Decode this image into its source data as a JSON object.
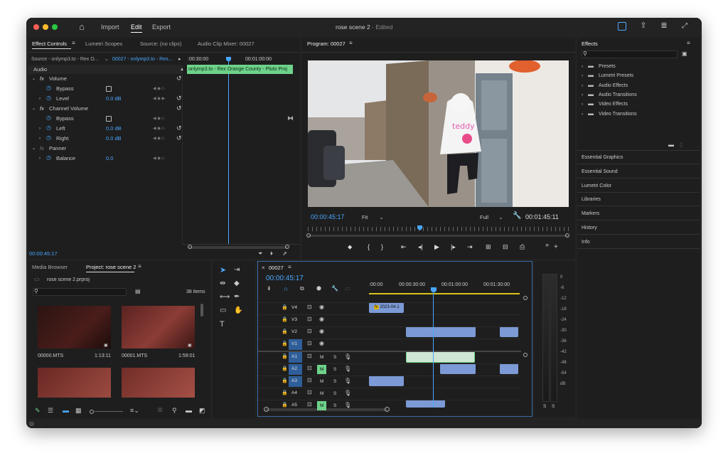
{
  "title_bar": {
    "home": "⌂",
    "import": "Import",
    "edit": "Edit",
    "export": "Export",
    "title": "rose scene 2",
    "edited": " - Edited"
  },
  "effect_controls": {
    "tab_effect": "Effect Controls",
    "tab_lumetri": "Lumetri Scopes",
    "tab_source": "Source: (no clips)",
    "tab_mixer": "Audio Clip Mixer: 00027",
    "source_label": "Source - onlymp3.to - Rex O...",
    "seq_label": "00027 - onlymp3.to - Rex...",
    "ruler_start": ":00:30:00",
    "ruler_end": "00:01:00:00",
    "clip": "onlymp3.to - Rex Orange County - Pluto Proj",
    "section": "Audio",
    "rows": [
      {
        "name": "Volume",
        "fx": "fx",
        "kind": "group"
      },
      {
        "name": "Bypass",
        "kind": "check"
      },
      {
        "name": "Level",
        "value": "0.0 dB",
        "kind": "param"
      },
      {
        "name": "Channel Volume",
        "fx": "fx",
        "kind": "group"
      },
      {
        "name": "Bypass",
        "kind": "check"
      },
      {
        "name": "Left",
        "value": "0.0 dB",
        "kind": "param"
      },
      {
        "name": "Right",
        "value": "0.0 dB",
        "kind": "param"
      },
      {
        "name": "Panner",
        "fx": "fx",
        "kind": "group"
      },
      {
        "name": "Balance",
        "value": "0.0",
        "kind": "param"
      }
    ],
    "timecode": "00:00:45:17"
  },
  "program": {
    "tab": "Program: 00027",
    "timecode": "00:00:45:17",
    "fit": "Fit",
    "full": "Full",
    "duration": "00:01:45:11"
  },
  "effects": {
    "title": "Effects",
    "folders": [
      "Presets",
      "Lumetri Presets",
      "Audio Effects",
      "Audio Transitions",
      "Video Effects",
      "Video Transitions"
    ],
    "panels": [
      "Essential Graphics",
      "Essential Sound",
      "Lumetri Color",
      "Libraries",
      "Markers",
      "History",
      "Info"
    ]
  },
  "project": {
    "tab_media": "Media Browser",
    "tab_project": "Project: rose scene 2",
    "file": "rose scene 2.prproj",
    "count": "38 items",
    "items": [
      {
        "name": "00000.MTS",
        "dur": "1:13:11"
      },
      {
        "name": "00001.MTS",
        "dur": "1:59:01"
      }
    ]
  },
  "timeline": {
    "tab": "00027",
    "timecode": "00:00:45:17",
    "ruler": [
      ":00:00",
      "00:00:30:00",
      "00:01:00:00",
      "00:01:30:00"
    ],
    "tracks": [
      {
        "name": "V4",
        "type": "v"
      },
      {
        "name": "V3",
        "type": "v"
      },
      {
        "name": "V2",
        "type": "v"
      },
      {
        "name": "V1",
        "type": "v"
      },
      {
        "name": "A1",
        "type": "a"
      },
      {
        "name": "A2",
        "type": "a"
      },
      {
        "name": "A3",
        "type": "a"
      },
      {
        "name": "A4",
        "type": "a"
      },
      {
        "name": "A5",
        "type": "a"
      }
    ],
    "graphic_clip": "2023-04-1"
  },
  "meters": {
    "scale": [
      "0",
      "-6",
      "-12",
      "-18",
      "-24",
      "-30",
      "-36",
      "-42",
      "-48",
      "-54",
      "dB"
    ],
    "solo": [
      "S",
      "S"
    ]
  }
}
